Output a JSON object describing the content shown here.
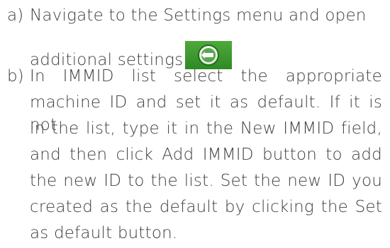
{
  "steps": [
    {
      "marker": "a)",
      "lines": [
        "Navigate to the Settings menu and open",
        "additional settings"
      ],
      "icon": "additional-settings-icon"
    },
    {
      "marker": "b)",
      "lines": [
        "In IMMID list select the appropriate",
        "machine ID and set it as default. If it is not",
        "in the list, type it in the New IMMID field,",
        "and then click Add IMMID button to add",
        "the new ID to the list. Set the new ID you",
        "created as the default by clicking the Set",
        "as default button."
      ]
    }
  ],
  "colors": {
    "text": "#3f3f3f",
    "icon_background": "#3a9a2e",
    "icon_circle": "#ffffff"
  }
}
